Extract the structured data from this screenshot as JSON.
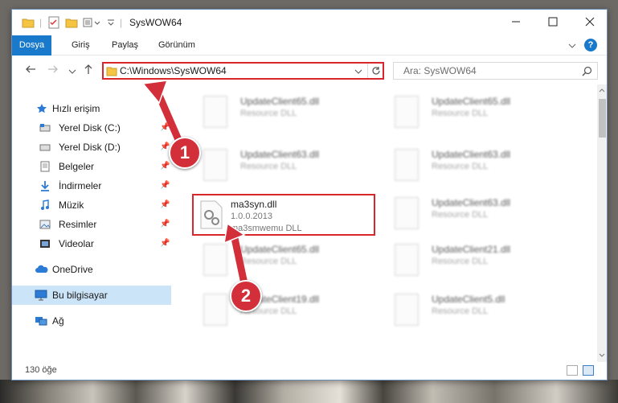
{
  "window": {
    "title": "SysWOW64"
  },
  "ribbon": {
    "tabs": [
      "Dosya",
      "Giriş",
      "Paylaş",
      "Görünüm"
    ]
  },
  "address": {
    "path": "C:\\Windows\\SysWOW64",
    "search_placeholder": "Ara: SysWOW64"
  },
  "nav": {
    "items": [
      {
        "label": "Hızlı erişim",
        "icon": "star-icon"
      },
      {
        "label": "Yerel Disk (C:)",
        "icon": "drive-icon"
      },
      {
        "label": "Yerel Disk (D:)",
        "icon": "drive-icon"
      },
      {
        "label": "Belgeler",
        "icon": "documents-icon"
      },
      {
        "label": "İndirmeler",
        "icon": "downloads-icon"
      },
      {
        "label": "Müzik",
        "icon": "music-icon"
      },
      {
        "label": "Resimler",
        "icon": "pictures-icon"
      },
      {
        "label": "Videolar",
        "icon": "videos-icon"
      },
      {
        "label": "OneDrive",
        "icon": "cloud-icon"
      },
      {
        "label": "Bu bilgisayar",
        "icon": "computer-icon"
      },
      {
        "label": "Ağ",
        "icon": "network-icon"
      }
    ]
  },
  "files": {
    "left": [
      {
        "name": "UpdateClient65.dll",
        "desc": "Resource DLL"
      },
      {
        "name": "UpdateClient63.dll",
        "desc": "Resource DLL"
      },
      {
        "name": "UpdateClient65.dll",
        "desc": "Resource DLL"
      },
      {
        "name": "UpdateClient19.dll",
        "desc": "Resource DLL"
      }
    ],
    "right": [
      {
        "name": "UpdateClient65.dll",
        "desc": "Resource DLL"
      },
      {
        "name": "UpdateClient63.dll",
        "desc": "Resource DLL"
      },
      {
        "name": "UpdateClient63.dll",
        "desc": "Resource DLL"
      },
      {
        "name": "UpdateClient21.dll",
        "desc": "Resource DLL"
      },
      {
        "name": "UpdateClient5.dll",
        "desc": "Resource DLL"
      }
    ],
    "selected": {
      "name": "ma3syn.dll",
      "version": "1.0.0.2013",
      "desc": "ma3smwemu DLL"
    }
  },
  "status": {
    "count": "130 öğe"
  },
  "annotations": {
    "badge1": "1",
    "badge2": "2"
  },
  "colors": {
    "accent": "#1979ca",
    "highlight": "#d9262c",
    "badge": "#d32f3a"
  }
}
